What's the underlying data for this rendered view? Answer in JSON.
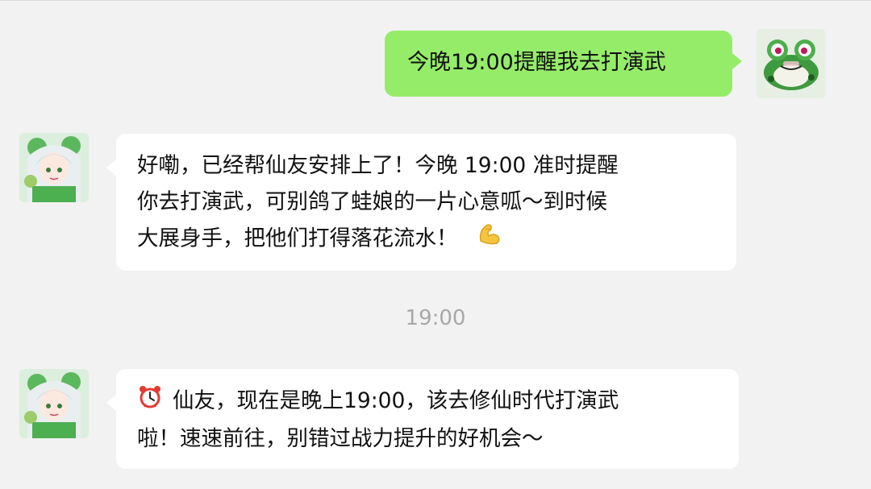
{
  "messages": [
    {
      "direction": "out",
      "sender": "user",
      "avatar_icon": "frog-avatar-icon",
      "text": "今晚19:00提醒我去打演武"
    },
    {
      "direction": "in",
      "sender": "assistant",
      "avatar_icon": "anime-girl-avatar-icon",
      "text": "好嘞，已经帮仙友安排上了！今晚 19:00 准时提醒你去打演武，可别鸽了蛙娘的一片心意呱～到时候大展身手，把他们打得落花流水！",
      "lines": [
        "好嘞，已经帮仙友安排上了！今晚 19:00 准时提醒",
        "你去打演武，可别鸽了蛙娘的一片心意呱～到时候",
        "大展身手，把他们打得落花流水！"
      ],
      "trailing_emoji": "flexed-biceps-icon"
    },
    {
      "direction": "in",
      "sender": "assistant",
      "avatar_icon": "anime-girl-avatar-icon",
      "leading_emoji": "alarm-clock-icon",
      "text": "仙友，现在是晚上19:00，该去修仙时代打演武啦！速速前往，别错过战力提升的好机会～",
      "lines": [
        "仙友，现在是晚上19:00，该去修仙时代打演武",
        "啦！速速前往，别错过战力提升的好机会～"
      ]
    }
  ],
  "timestamp": "19:00",
  "colors": {
    "background": "#f2f2f2",
    "outgoing_bubble": "#95ec69",
    "incoming_bubble": "#ffffff",
    "timestamp_text": "#a8a8a8"
  }
}
